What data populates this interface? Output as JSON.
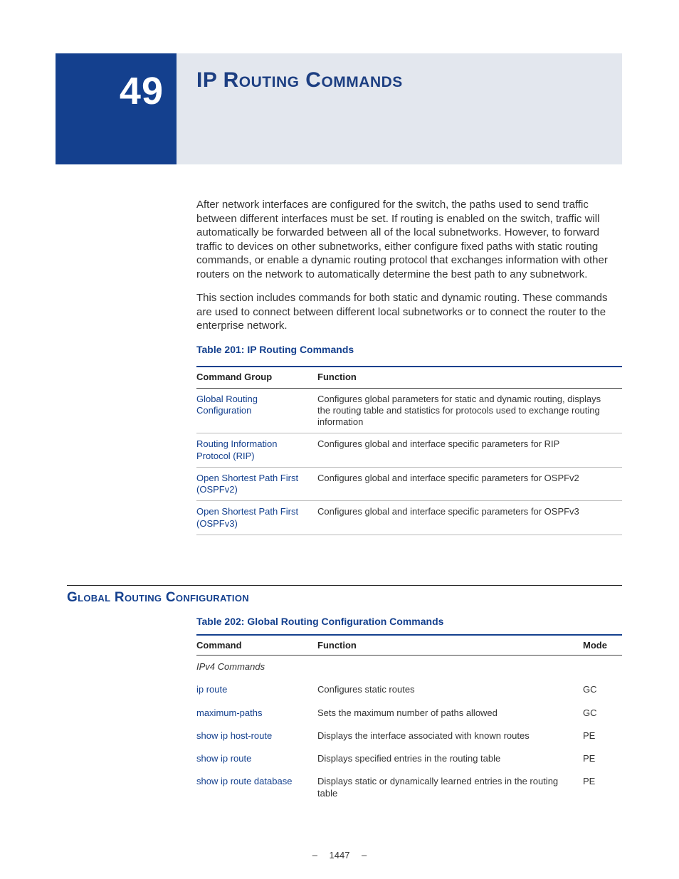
{
  "chapter": {
    "number": "49",
    "title": "IP Routing Commands"
  },
  "intro_p1": "After network interfaces are configured for the switch, the paths used to send traffic between different interfaces must be set. If routing is enabled on the switch, traffic will automatically be forwarded between all of the local subnetworks. However, to forward traffic to devices on other subnetworks, either configure fixed paths with static routing commands, or enable a dynamic routing protocol that exchanges information with other routers on the network to automatically determine the best path to any subnetwork.",
  "intro_p2": "This section includes commands for both static and dynamic routing. These commands are used to connect between different local subnetworks or to connect the router to the enterprise network.",
  "table201": {
    "caption": "Table 201: IP Routing Commands",
    "headers": {
      "c1": "Command Group",
      "c2": "Function"
    },
    "rows": [
      {
        "group": "Global Routing Configuration",
        "func": "Configures global parameters for static and dynamic routing, displays the routing table and statistics for protocols used to exchange routing information"
      },
      {
        "group": "Routing Information Protocol (RIP)",
        "func": "Configures global and interface specific parameters for RIP"
      },
      {
        "group": "Open Shortest Path First (OSPFv2)",
        "func": "Configures global and interface specific parameters for OSPFv2"
      },
      {
        "group": "Open Shortest Path First (OSPFv3)",
        "func": "Configures global and interface specific parameters for OSPFv3"
      }
    ]
  },
  "section_heading": "Global Routing Configuration",
  "table202": {
    "caption": "Table 202: Global Routing Configuration Commands",
    "headers": {
      "c1": "Command",
      "c2": "Function",
      "c3": "Mode"
    },
    "subhead": "IPv4 Commands",
    "rows": [
      {
        "cmd": "ip route",
        "func": "Configures static routes",
        "mode": "GC"
      },
      {
        "cmd": "maximum-paths",
        "func": "Sets the maximum number of paths allowed",
        "mode": "GC"
      },
      {
        "cmd": "show ip host-route",
        "func": "Displays the interface associated with known routes",
        "mode": "PE"
      },
      {
        "cmd": "show ip route",
        "func": "Displays specified entries in the routing table",
        "mode": "PE"
      },
      {
        "cmd": "show ip route database",
        "func": "Displays static or dynamically learned entries in the routing table",
        "mode": "PE"
      }
    ]
  },
  "page_number": "–  1447  –"
}
